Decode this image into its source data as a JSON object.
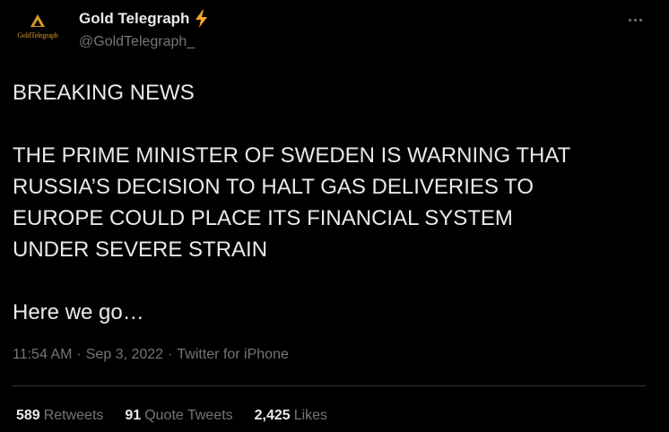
{
  "tweet": {
    "author": {
      "avatar_wordmark": "GoldTelegraph",
      "display_name": "Gold Telegraph",
      "handle": "@GoldTelegraph_",
      "verified_emoji": "lightning-bolt-icon"
    },
    "lines": {
      "headline": "BREAKING NEWS",
      "body_line_1": "THE PRIME MINISTER OF SWEDEN IS WARNING THAT",
      "body_line_2": "RUSSIA’S DECISION TO HALT GAS DELIVERIES TO",
      "body_line_3": "EUROPE COULD PLACE ITS FINANCIAL SYSTEM",
      "body_line_4": "UNDER SEVERE STRAIN",
      "closing": "Here we go…"
    },
    "meta": {
      "time": "11:54 AM",
      "separator": "·",
      "date": "Sep 3, 2022",
      "source": "Twitter for iPhone"
    },
    "stats": {
      "retweets": {
        "count": "589",
        "label": "Retweets"
      },
      "quote_tweets": {
        "count": "91",
        "label": "Quote Tweets"
      },
      "likes": {
        "count": "2,425",
        "label": "Likes"
      }
    }
  },
  "colors": {
    "background": "#000000",
    "primary_text": "#e7e9ea",
    "secondary_text": "#71767b",
    "bolt": "#f5a623",
    "brand_gold": "#d79a2b",
    "divider": "#2f3336"
  }
}
